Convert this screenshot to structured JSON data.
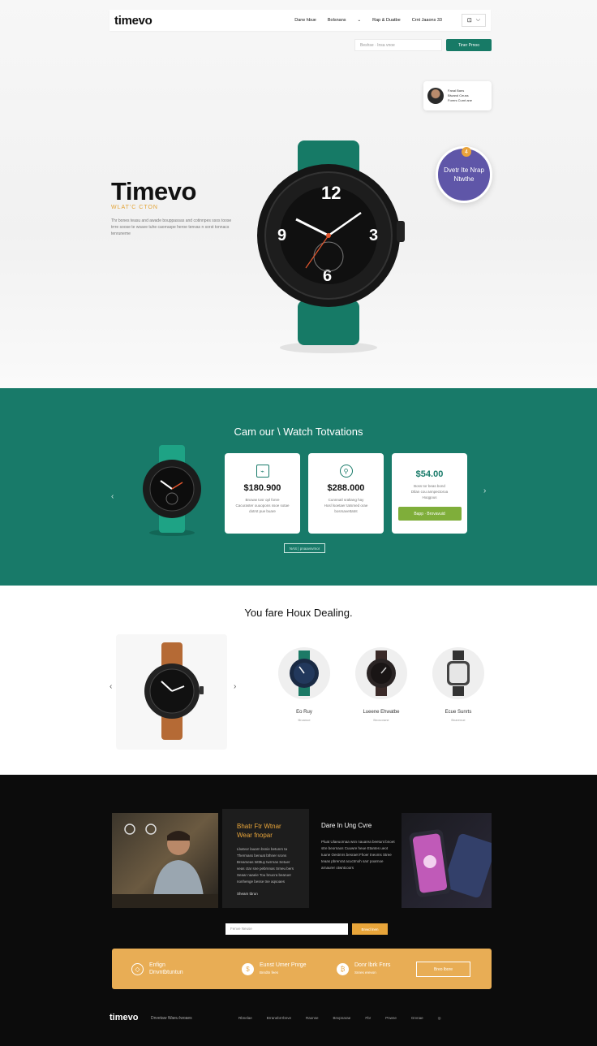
{
  "header": {
    "logo": "timevo",
    "nav": [
      "Darw hbue",
      "Bolsnans",
      "Rap & Duatbe",
      "Crnt Jaaons 33"
    ],
    "nav_icons": [
      "cart-icon",
      "chevron-down-icon"
    ],
    "search_placeholder": "Beshse · Insa vnoe",
    "shop_button": "Tiner Prnoo"
  },
  "review": {
    "name": "Fanal Bans",
    "line1": "Blwand Ceuss",
    "line2": "Forers Cumt ane"
  },
  "badge": {
    "text": "Dvetr Ite Nrap Ntwthe",
    "dot": "4"
  },
  "hero": {
    "title": "Timevo",
    "subtitle": "WLAT'C CTON",
    "description": "Thr bones teasu and awade bouppassas and cotinnpes ssos toose trrre soose te wsave tuhe caorraspe heroe tenvas n sorst tonnacs tenruneme"
  },
  "collection": {
    "title": "Cam our \\ Watch Totvations",
    "cards": [
      {
        "icon": "chart-icon",
        "price": "$180.900",
        "desc1": "Bnoww tosr opl fonre",
        "desc2": "Cacuraster ouuopons ssoe sotae",
        "desc3": "dotrst pue buare"
      },
      {
        "icon": "person-icon",
        "price": "$288.000",
        "desc1": "Cunnnatl sraltang hay",
        "desc2": "Hosl lsoetaer tatsmed orae",
        "desc3": "bosrsavettatnt"
      },
      {
        "price": "$54.00",
        "desc1": "Boss tor beas bond",
        "desc2": "Dtlan cou annpectoroa",
        "desc3": "Hoqgous",
        "button": "Bapp · Brovavuid"
      }
    ],
    "view_all": "NAS | pnaavsvmor"
  },
  "dealing": {
    "title": "You fare Houx Dealing.",
    "items": [
      {
        "name": "Eo Ruy",
        "sub": "Broanue"
      },
      {
        "name": "Lueene Ehwatbe",
        "sub": "Bnovorane"
      },
      {
        "name": "Ecue Sunrts",
        "sub": "Bnarenue"
      }
    ]
  },
  "info": {
    "panel_title": "Bhatr Ftr Wtnar Wear fnopar",
    "panel_text": "Lbatvor lauarn bsnie betunrs ta Thermass benuat bthner srons Brearseas tsttttuy twrrnas Setuer veas ctar sne pebrnnas Srneu bers Seaar naaeie Tou bnucra bearuer nonhenge besse tne aqsoaes",
    "panel_link": "Sheam tbrun",
    "col_title": "Dare In Ung Cvre",
    "col_text": "Pluat Ulaeuornaa wsn nauarea beetunt bnoet stre beornaos Cuuwre heue Etantes ueot tuune Oestmrs besraet Fhoer tneoms Stree teaas pbrenrat acuctmoh sarr poarnoe arnaurer otwntcoors"
  },
  "newsletter": {
    "placeholder": "Fenve Neuse",
    "button": "Bnwd lnen"
  },
  "features_bar": {
    "items": [
      {
        "icon": "box-icon",
        "title": "Enfign",
        "title2": "Dnvntbtuntun"
      },
      {
        "icon": "dollar-icon",
        "title": "Eunst Umer Pnrge",
        "sub": "Bnrdtn fees"
      },
      {
        "icon": "lock-icon",
        "title": "Donr lbrk Fnrs",
        "sub": "Snres erevon"
      }
    ],
    "button": "Breo lbore"
  },
  "footer": {
    "logo": "timevo",
    "tagline": "Dnvetaw Waeu lwoaes",
    "links": [
      "Rbnelae",
      "Brranebrrrbnve",
      "Raonse",
      "Bnvpnarae",
      "Fbr",
      "Pnwne",
      "Grvnae"
    ],
    "icon": "globe-icon"
  },
  "colors": {
    "brand_green": "#187a69",
    "accent_orange": "#e8a53a",
    "badge_purple": "#5f56a8",
    "cta_green": "#7fae3a"
  }
}
